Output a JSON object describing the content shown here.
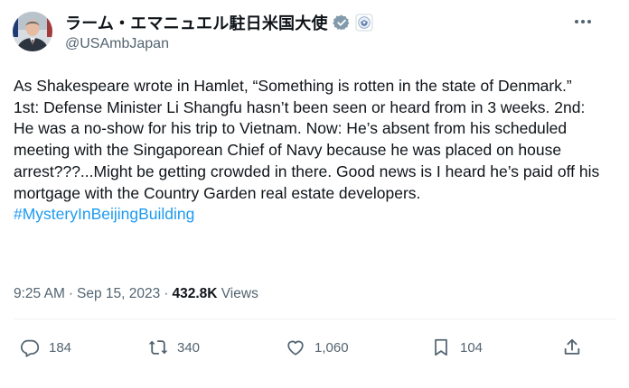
{
  "author": {
    "display_name": "ラーム・エマニュエル駐日米国大使",
    "handle": "@USAmbJapan"
  },
  "tweet": {
    "text": "As Shakespeare wrote in Hamlet, “Something is rotten in the state of Denmark.” 1st: Defense Minister Li Shangfu hasn’t been seen or heard from in 3 weeks. 2nd: He was a no-show for his trip to Vietnam. Now: He’s absent from his scheduled meeting with the Singaporean Chief of Navy because he was placed on house arrest???...Might be getting crowded in there. Good news is I heard he’s paid off his mortgage with the Country Garden real estate developers.",
    "hashtag": "#MysteryInBeijingBuilding"
  },
  "meta": {
    "time": "9:25 AM",
    "date": "Sep 15, 2023",
    "views_count": "432.8K",
    "views_label": "Views"
  },
  "actions": {
    "replies": "184",
    "reposts": "340",
    "likes": "1,060",
    "bookmarks": "104"
  },
  "icons": {
    "avatar": "avatar-portrait",
    "verified": "verified-badge-icon",
    "affiliation": "us-government-seal-icon",
    "more": "more-dots-icon",
    "reply": "reply-icon",
    "repost": "repost-icon",
    "like": "heart-icon",
    "bookmark": "bookmark-icon",
    "share": "share-icon"
  },
  "colors": {
    "text": "#0f1419",
    "secondary": "#536471",
    "hashtag": "#1d9bf0",
    "verified": "#829aab"
  }
}
